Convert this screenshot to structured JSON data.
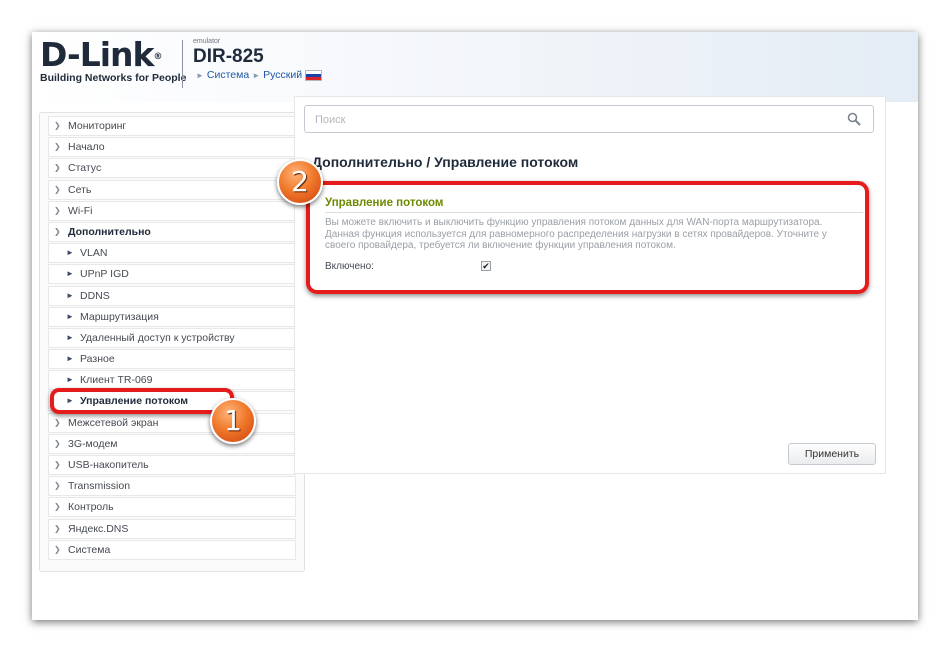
{
  "header": {
    "logo_text": "D-Link",
    "logo_reg": "®",
    "tagline": "Building Networks for People",
    "emulator": "emulator",
    "model": "DIR-825",
    "breadcrumb_system": "Система",
    "breadcrumb_language": "Русский"
  },
  "sidebar": {
    "items": [
      {
        "label": "Мониторинг"
      },
      {
        "label": "Начало"
      },
      {
        "label": "Статус"
      },
      {
        "label": "Сеть"
      },
      {
        "label": "Wi-Fi"
      },
      {
        "label": "Дополнительно"
      },
      {
        "label": "VLAN"
      },
      {
        "label": "UPnP IGD"
      },
      {
        "label": "DDNS"
      },
      {
        "label": "Маршрутизация"
      },
      {
        "label": "Удаленный доступ к устройству"
      },
      {
        "label": "Разное"
      },
      {
        "label": "Клиент TR-069"
      },
      {
        "label": "Управление потоком"
      },
      {
        "label": "Межсетевой экран"
      },
      {
        "label": "3G-модем"
      },
      {
        "label": "USB-накопитель"
      },
      {
        "label": "Transmission"
      },
      {
        "label": "Контроль"
      },
      {
        "label": "Яндекс.DNS"
      },
      {
        "label": "Система"
      }
    ]
  },
  "search": {
    "placeholder": "Поиск"
  },
  "page": {
    "title": "Дополнительно /  Управление потоком",
    "section_title": "Управление потоком",
    "description": "Вы можете включить и выключить функцию управления потоком данных для WAN-порта маршрутизатора. Данная функция используется для равномерного распределения нагрузки в сетях провайдеров. Уточните у своего провайдера, требуется ли включение функции управления потоком.",
    "enabled_label": "Включено:",
    "enabled": true,
    "apply_label": "Применить"
  },
  "annotations": {
    "badge1": "1",
    "badge2": "2",
    "highlight_color": "#e61b1b"
  }
}
